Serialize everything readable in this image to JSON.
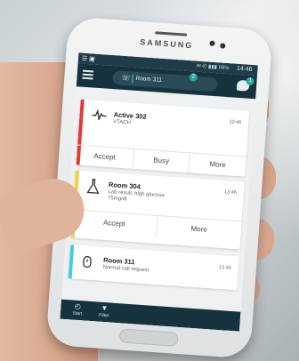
{
  "phone": {
    "brand": "SAMSUNG"
  },
  "status_bar": {
    "left": "☰  ▣",
    "icons": "✉ ✆ ▮▮▮ 68%",
    "time": "14:46"
  },
  "header": {
    "room_label": "Room 311",
    "badge": "2",
    "chat_badge": "1"
  },
  "cards": [
    {
      "stripe_color": "#e53935",
      "icon": "heartbeat-icon",
      "title": "Active 302",
      "subtitle": "VTACH",
      "time": "12:46",
      "actions": [
        "Accept",
        "Busy",
        "More"
      ]
    },
    {
      "stripe_color": "#f4d23c",
      "icon": "flask-icon",
      "title": "Room 304",
      "subtitle": "Lab result: high glucose",
      "subtitle2": "75mg/dl",
      "time": "13:46",
      "actions": [
        "Accept",
        "More"
      ]
    },
    {
      "stripe_color": "#3fd0e0",
      "icon": "call-icon",
      "title": "Room 311",
      "subtitle": "Normal call request",
      "time": "12:46"
    }
  ],
  "bottom_nav": {
    "start": "Start",
    "filter": "Filter"
  }
}
